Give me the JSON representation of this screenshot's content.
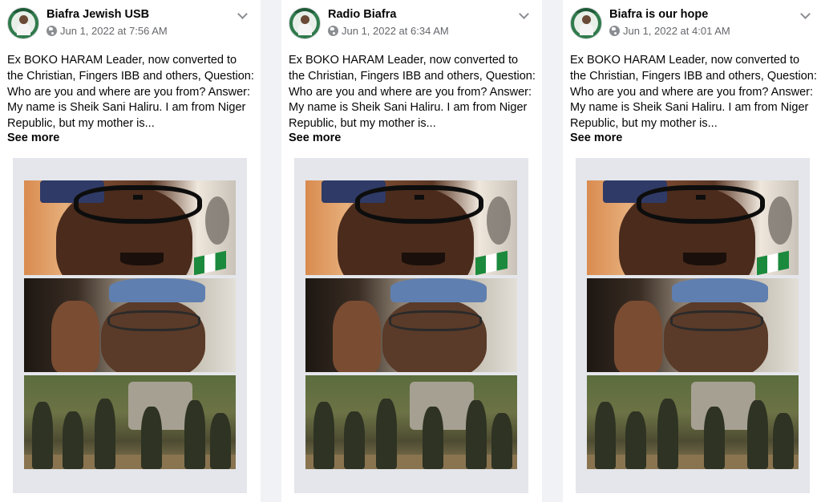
{
  "posts": [
    {
      "page_name": "Biafra Jewish USB",
      "date": "Jun 1, 2022 at 7:56 AM",
      "text": "Ex BOKO HARAM Leader, now converted to the Christian, Fingers IBB and others, Question: Who are you and where are you from? Answer: My name is Sheik Sani Haliru. I am from Niger Republic, but my mother is...",
      "see_more": "See more"
    },
    {
      "page_name": "Radio Biafra",
      "date": "Jun 1, 2022 at 6:34 AM",
      "text": "Ex BOKO HARAM Leader, now converted to the Christian, Fingers IBB and others, Question: Who are you and where are you from? Answer: My name is Sheik Sani Haliru. I am from Niger Republic, but my mother is...",
      "see_more": "See more"
    },
    {
      "page_name": "Biafra is our hope",
      "date": "Jun 1, 2022 at 4:01 AM",
      "text": "Ex BOKO HARAM Leader, now converted to the Christian, Fingers IBB and others, Question: Who are you and where are you from? Answer: My name is Sheik Sani Haliru. I am from Niger Republic, but my mother is...",
      "see_more": "See more"
    }
  ],
  "icons": {
    "audience": "globe-icon",
    "options": "chevron-down-icon"
  },
  "colors": {
    "background": "#f0f2f5",
    "card": "#ffffff",
    "secondary_text": "#65676b",
    "media_frame": "#e4e6eb"
  }
}
